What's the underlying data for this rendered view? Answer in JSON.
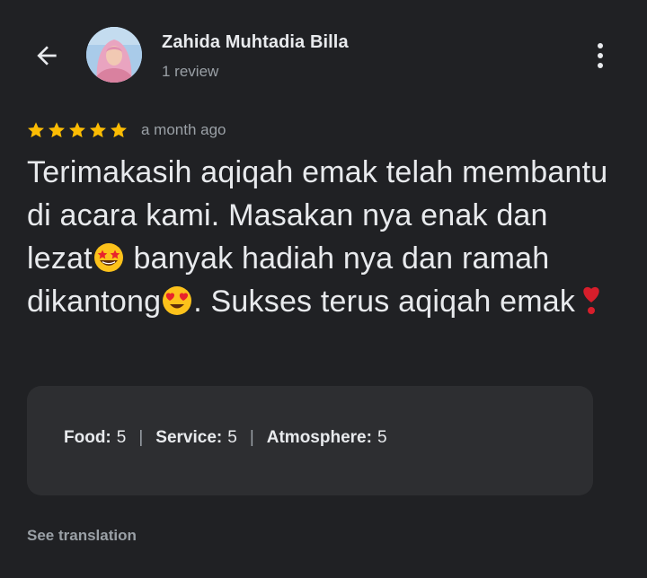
{
  "header": {
    "back_icon": "arrow-left-icon",
    "author_name": "Zahida Muhtadia Billa",
    "review_count": "1 review",
    "more_icon": "more-vert-icon"
  },
  "review": {
    "star_rating": 5,
    "star_color": "#fbbc04",
    "time_ago": "a month ago",
    "text_segments": [
      "Terimakasih aqiqah emak telah membantu di acara kami. Masakan nya enak dan lezat",
      " banyak hadiah nya dan ramah dikantong",
      ". Sukses terus aqiqah emak"
    ],
    "emojis": [
      "star-struck-emoji",
      "heart-eyes-emoji",
      "heart-exclamation-emoji"
    ]
  },
  "sub_ratings": [
    {
      "label": "Food:",
      "value": "5"
    },
    {
      "label": "Service:",
      "value": "5"
    },
    {
      "label": "Atmosphere:",
      "value": "5"
    }
  ],
  "sub_rating_separator": "|",
  "footer": {
    "see_translation": "See translation"
  }
}
